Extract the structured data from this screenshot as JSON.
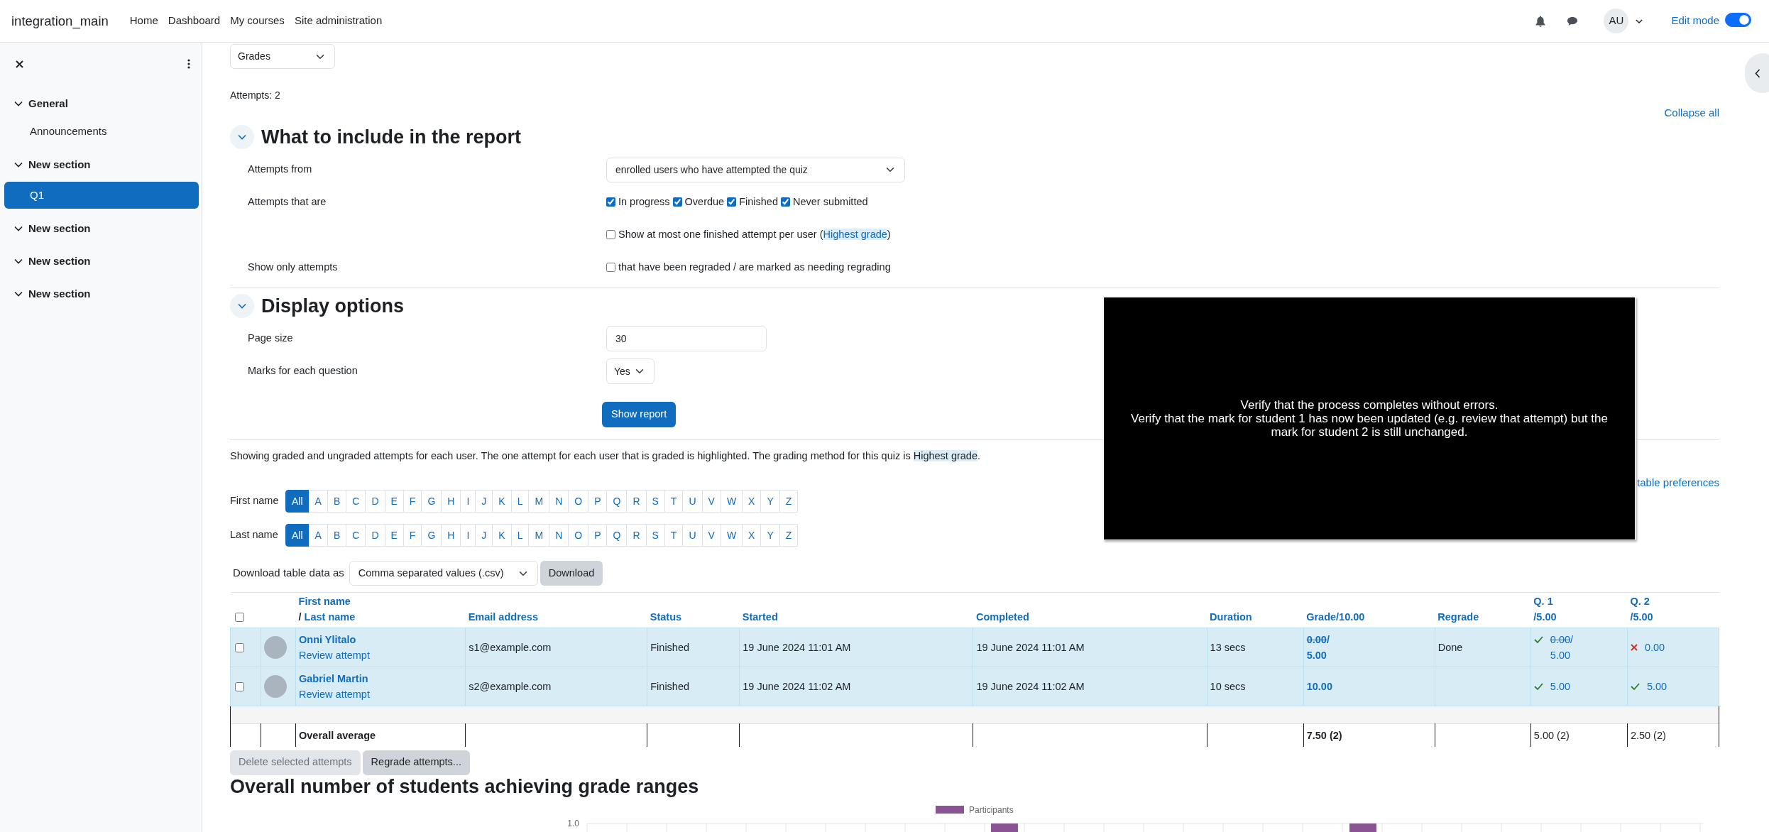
{
  "navbar": {
    "brand": "integration_main",
    "links": [
      "Home",
      "Dashboard",
      "My courses",
      "Site administration"
    ],
    "avatar": "AU",
    "edit_mode": {
      "label": "Edit mode",
      "on": true
    }
  },
  "sidebar": {
    "items": [
      {
        "kind": "section",
        "label": "General",
        "expanded": true,
        "children": [
          {
            "kind": "activity",
            "label": "Announcements",
            "selected": false
          }
        ]
      },
      {
        "kind": "section",
        "label": "New section",
        "expanded": true,
        "children": [
          {
            "kind": "activity",
            "label": "Q1",
            "selected": true
          }
        ]
      },
      {
        "kind": "section",
        "label": "New section",
        "expanded": true
      },
      {
        "kind": "section",
        "label": "New section",
        "expanded": true
      },
      {
        "kind": "section",
        "label": "New section",
        "expanded": true
      }
    ]
  },
  "report_select": "Grades",
  "attempts_count": "Attempts: 2",
  "collapse_all": "Collapse all",
  "sections": [
    {
      "title": "What to include in the report",
      "expanded": true,
      "fields": [
        {
          "kind": "select",
          "label": "Attempts from",
          "value": "enrolled users who have attempted the quiz"
        },
        {
          "kind": "checkboxes",
          "label": "Attempts that are",
          "options": [
            {
              "label": "In progress",
              "checked": true
            },
            {
              "label": "Overdue",
              "checked": true
            },
            {
              "label": "Finished",
              "checked": true
            },
            {
              "label": "Never submitted",
              "checked": true
            }
          ]
        },
        {
          "kind": "checkbox",
          "checked": false,
          "text": "Show at most one finished attempt per user (",
          "link": "Highest grade",
          "text_after": ")"
        },
        {
          "kind": "checkbox",
          "label": "Show only attempts",
          "checked": false,
          "text": "that have been regraded / are marked as needing regrading"
        }
      ]
    },
    {
      "title": "Display options",
      "expanded": true,
      "fields": [
        {
          "kind": "input",
          "label": "Page size",
          "value": "30"
        },
        {
          "kind": "small-select",
          "label": "Marks for each question",
          "value": "Yes"
        },
        {
          "kind": "button",
          "text": "Show report"
        }
      ]
    }
  ],
  "summary": {
    "text": "Showing graded and ungraded attempts for each user. The one attempt for each user that is graded is highlighted. The grading method for this quiz is ",
    "link": "Highest grade",
    "text_after": "."
  },
  "reset_link": "table preferences",
  "initials_bars": [
    {
      "label": "First name",
      "letters": [
        {
          "label": "All",
          "selected": true
        },
        {
          "label": "A",
          "selected": false
        },
        {
          "label": "B",
          "selected": false
        },
        {
          "label": "C",
          "selected": false
        },
        {
          "label": "D",
          "selected": false
        },
        {
          "label": "E",
          "selected": false
        },
        {
          "label": "F",
          "selected": false
        },
        {
          "label": "G",
          "selected": false
        },
        {
          "label": "H",
          "selected": false
        },
        {
          "label": "I",
          "selected": false
        },
        {
          "label": "J",
          "selected": false
        },
        {
          "label": "K",
          "selected": false
        },
        {
          "label": "L",
          "selected": false
        },
        {
          "label": "M",
          "selected": false
        },
        {
          "label": "N",
          "selected": false
        },
        {
          "label": "O",
          "selected": false
        },
        {
          "label": "P",
          "selected": false
        },
        {
          "label": "Q",
          "selected": false
        },
        {
          "label": "R",
          "selected": false
        },
        {
          "label": "S",
          "selected": false
        },
        {
          "label": "T",
          "selected": false
        },
        {
          "label": "U",
          "selected": false
        },
        {
          "label": "V",
          "selected": false
        },
        {
          "label": "W",
          "selected": false
        },
        {
          "label": "X",
          "selected": false
        },
        {
          "label": "Y",
          "selected": false
        },
        {
          "label": "Z",
          "selected": false
        }
      ]
    },
    {
      "label": "Last name",
      "letters": [
        {
          "label": "All",
          "selected": true
        },
        {
          "label": "A",
          "selected": false
        },
        {
          "label": "B",
          "selected": false
        },
        {
          "label": "C",
          "selected": false
        },
        {
          "label": "D",
          "selected": false
        },
        {
          "label": "E",
          "selected": false
        },
        {
          "label": "F",
          "selected": false
        },
        {
          "label": "G",
          "selected": false
        },
        {
          "label": "H",
          "selected": false
        },
        {
          "label": "I",
          "selected": false
        },
        {
          "label": "J",
          "selected": false
        },
        {
          "label": "K",
          "selected": false
        },
        {
          "label": "L",
          "selected": false
        },
        {
          "label": "M",
          "selected": false
        },
        {
          "label": "N",
          "selected": false
        },
        {
          "label": "O",
          "selected": false
        },
        {
          "label": "P",
          "selected": false
        },
        {
          "label": "Q",
          "selected": false
        },
        {
          "label": "R",
          "selected": false
        },
        {
          "label": "S",
          "selected": false
        },
        {
          "label": "T",
          "selected": false
        },
        {
          "label": "U",
          "selected": false
        },
        {
          "label": "V",
          "selected": false
        },
        {
          "label": "W",
          "selected": false
        },
        {
          "label": "X",
          "selected": false
        },
        {
          "label": "Y",
          "selected": false
        },
        {
          "label": "Z",
          "selected": false
        }
      ]
    }
  ],
  "download": {
    "label": "Download table data as",
    "format": "Comma separated values (.csv)",
    "button": "Download"
  },
  "table": {
    "columns": [
      {
        "kind": "select",
        "checked": false
      },
      {
        "kind": "picture"
      },
      {
        "kind": "sortable",
        "label": "First name",
        "separator": "/",
        "label_2": "Last name"
      },
      {
        "kind": "sortable",
        "label": "Email address"
      },
      {
        "kind": "sortable",
        "label": "Status"
      },
      {
        "kind": "sortable",
        "label": "Started"
      },
      {
        "kind": "sortable",
        "label": "Completed"
      },
      {
        "kind": "sortable",
        "label": "Duration"
      },
      {
        "kind": "sortable",
        "label": "Grade/10.00"
      },
      {
        "kind": "sortable",
        "label": "Regrade"
      },
      {
        "kind": "sortable",
        "label": "Q. 1",
        "label_2": "/5.00"
      },
      {
        "kind": "sortable",
        "label": "Q. 2",
        "label_2": "/5.00"
      }
    ],
    "rows": [
      {
        "checked": false,
        "highlighted": true,
        "name": "Onni Ylitalo",
        "review": "Review attempt",
        "email": "s1@example.com",
        "status": "Finished",
        "started": "19 June 2024 11:01 AM",
        "completed": "19 June 2024 11:01 AM",
        "duration": "13 secs",
        "grade": {
          "old": "0.00",
          "separator": "/",
          "new": "5.00"
        },
        "regrade": "Done",
        "marks": [
          {
            "kind": "correct",
            "old": "0.00",
            "separator": "/",
            "new": "5.00"
          },
          {
            "kind": "incorrect",
            "new": "0.00"
          }
        ]
      },
      {
        "checked": false,
        "highlighted": true,
        "name": "Gabriel Martin",
        "review": "Review attempt",
        "email": "s2@example.com",
        "status": "Finished",
        "started": "19 June 2024 11:02 AM",
        "completed": "19 June 2024 11:02 AM",
        "duration": "10 secs",
        "grade": {
          "new": "10.00"
        },
        "marks": [
          {
            "kind": "correct",
            "new": "5.00"
          },
          {
            "kind": "correct",
            "new": "5.00"
          }
        ]
      }
    ],
    "average": {
      "label": "Overall average",
      "grade": "7.50 (2)",
      "marks": [
        "5.00 (2)",
        "2.50 (2)"
      ]
    }
  },
  "buttons": [
    {
      "label": "Delete selected attempts",
      "disabled": true
    },
    {
      "label": "Regrade attempts...",
      "disabled": false
    }
  ],
  "chart": {
    "title": "Overall number of students achieving grade ranges",
    "legend": "Participants",
    "tick": "1.0"
  },
  "caption": {
    "lines": [
      "Verify that the process completes without errors.",
      "Verify that the mark for student 1 has now been updated (e.g. review that attempt) but the mark for student 2 is still unchanged."
    ]
  }
}
